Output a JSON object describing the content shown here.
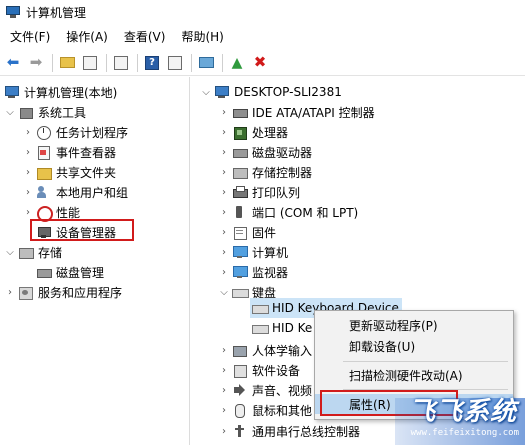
{
  "window": {
    "title": "计算机管理"
  },
  "menu": [
    "文件(F)",
    "操作(A)",
    "查看(V)",
    "帮助(H)"
  ],
  "left_tree": {
    "root": "计算机管理(本地)",
    "system_tools": "系统工具",
    "task_scheduler": "任务计划程序",
    "event_viewer": "事件查看器",
    "shared_folders": "共享文件夹",
    "local_users": "本地用户和组",
    "performance": "性能",
    "device_manager": "设备管理器",
    "storage": "存储",
    "disk_management": "磁盘管理",
    "services_apps": "服务和应用程序"
  },
  "device_tree": {
    "computer_name": "DESKTOP-SLI2381",
    "ide": "IDE ATA/ATAPI 控制器",
    "processors": "处理器",
    "disk_drives": "磁盘驱动器",
    "storage_controllers": "存储控制器",
    "print_queues": "打印队列",
    "ports": "端口 (COM 和 LPT)",
    "firmware": "固件",
    "computer": "计算机",
    "monitors": "监视器",
    "keyboards": "键盘",
    "hid_keyboard_1": "HID Keyboard Device",
    "hid_keyboard_2": "HID Ke",
    "hid": "人体学输入",
    "software_devices": "软件设备",
    "sound": "声音、视频",
    "mice": "鼠标和其他",
    "usb": "通用串行总线控制器"
  },
  "context_menu": {
    "update_driver": "更新驱动程序(P)",
    "uninstall": "卸载设备(U)",
    "scan": "扫描检测硬件改动(A)",
    "properties": "属性(R)"
  },
  "watermark": {
    "text": "飞飞系统",
    "url": "www.feifeixitong.com"
  },
  "colors": {
    "highlight_red": "#d11b1b",
    "selection_blue": "#cce4f7",
    "menu_highlight": "#bcd7f0"
  }
}
